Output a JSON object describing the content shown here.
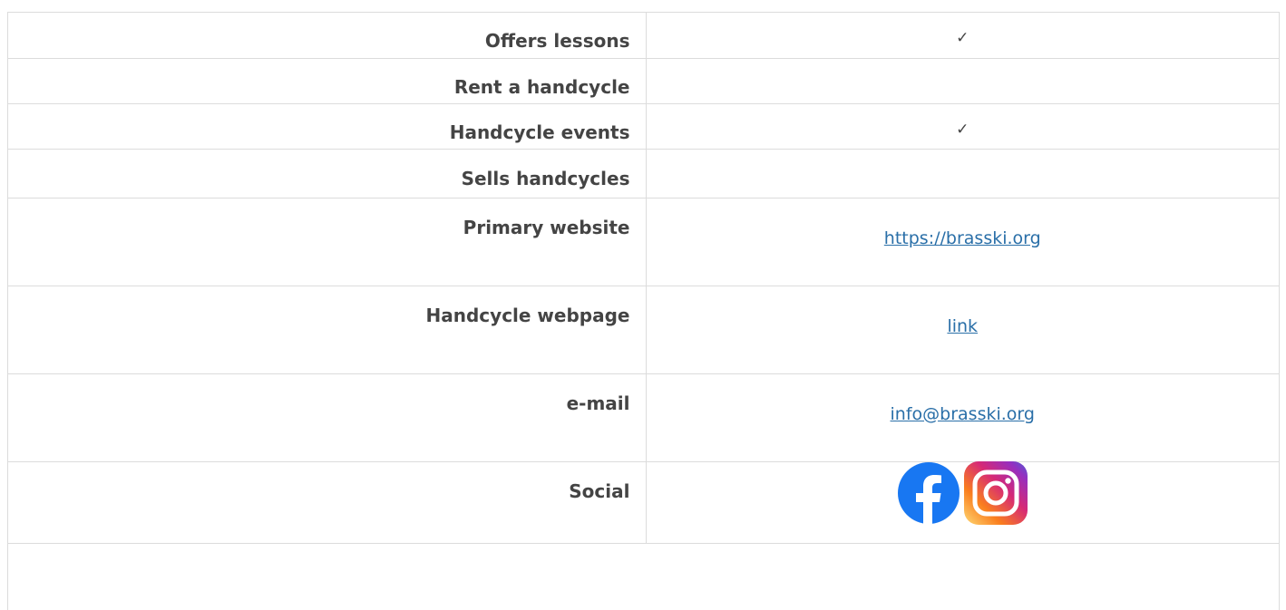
{
  "rows": [
    {
      "label": "Offers lessons",
      "value": "✓"
    },
    {
      "label": "Rent a handcycle",
      "value": ""
    },
    {
      "label": "Handcycle events",
      "value": "✓"
    },
    {
      "label": "Sells handcycles",
      "value": ""
    },
    {
      "label": "Primary website",
      "link": "https://brasski.org"
    },
    {
      "label": "Handcycle webpage",
      "link": "link"
    },
    {
      "label": "e-mail",
      "link": "info@brasski.org"
    },
    {
      "label": "Social",
      "icons": [
        "facebook-icon",
        "instagram-icon"
      ]
    }
  ],
  "colors": {
    "text": "#444444",
    "link": "#2a6fa8",
    "border": "#dcdcdc",
    "facebook": "#1877f2",
    "instagram_start": "#feda75",
    "instagram_mid": "#d62976",
    "instagram_end": "#4f5bd5"
  }
}
